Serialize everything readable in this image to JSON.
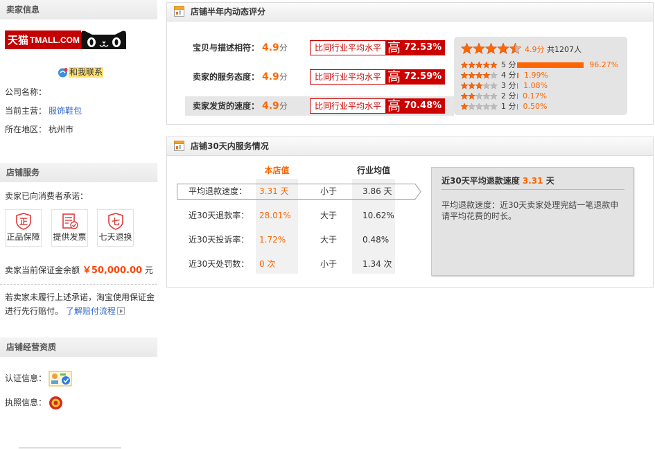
{
  "colors": {
    "accent": "#ff6600",
    "badge_red": "#cc0000",
    "link": "#3366cc"
  },
  "sidebar": {
    "seller_section": {
      "title": "卖家信息",
      "logo": {
        "cn": "天猫",
        "en": "TMALL.COM"
      },
      "contact_icon": "wangwang-chat-icon",
      "contact_label": "和我联系",
      "fields": [
        {
          "label": "公司名称：",
          "value": ""
        },
        {
          "label": "当前主营：",
          "value": "服饰鞋包"
        },
        {
          "label": "所在地区：",
          "value": "杭州市"
        }
      ]
    },
    "service_section": {
      "title": "店铺服务",
      "promise_label": "卖家已向消费者承诺：",
      "promises": [
        {
          "icon": "genuine-guarantee-icon",
          "glyph": "正",
          "label": "正品保障"
        },
        {
          "icon": "invoice-icon",
          "label": "提供发票"
        },
        {
          "icon": "seven-day-return-icon",
          "glyph": "七",
          "label": "七天退换"
        }
      ],
      "deposit": {
        "label": "卖家当前保证金余额",
        "amount": "￥50,000.00",
        "unit": "元"
      },
      "compensation_note": "若卖家未履行上述承诺，淘宝使用保证金进行先行赔付。",
      "compensation_link": "了解赔付流程"
    },
    "qualification_section": {
      "title": "店铺经营资质",
      "certification_label": "认证信息：",
      "certification_icon": "certification-icon",
      "license_label": "执照信息：",
      "license_icon": "business-license-icon"
    }
  },
  "dsr_panel": {
    "title": "店铺半年内动态评分",
    "items": [
      {
        "label": "宝贝与描述相符：",
        "score": "4.9",
        "unit": "分",
        "compare_text": "比同行业平均水平",
        "level": "高",
        "diff": "72.53%",
        "selected": false
      },
      {
        "label": "卖家的服务态度：",
        "score": "4.9",
        "unit": "分",
        "compare_text": "比同行业平均水平",
        "level": "高",
        "diff": "72.59%",
        "selected": false
      },
      {
        "label": "卖家发货的速度：",
        "score": "4.9",
        "unit": "分",
        "compare_text": "比同行业平均水平",
        "level": "高",
        "diff": "70.48%",
        "selected": true
      }
    ],
    "summary": {
      "stars_filled": 4.5,
      "score": "4.9分",
      "count": "共1207人",
      "distribution": [
        {
          "stars": 5,
          "label": "5 分",
          "percent": "96.27%"
        },
        {
          "stars": 4,
          "label": "4 分",
          "percent": "1.99%"
        },
        {
          "stars": 3,
          "label": "3 分",
          "percent": "1.08%"
        },
        {
          "stars": 2,
          "label": "2 分",
          "percent": "0.17%"
        },
        {
          "stars": 1,
          "label": "1 分",
          "percent": "0.50%"
        }
      ]
    }
  },
  "service_panel": {
    "title": "店铺30天内服务情况",
    "columns": {
      "shop": "本店值",
      "industry": "行业均值"
    },
    "rows": [
      {
        "label": "平均退款速度：",
        "shop": "3.31 天",
        "compare": "小于",
        "industry": "3.86 天",
        "selected": true
      },
      {
        "label": "近30天退款率：",
        "shop": "28.01%",
        "compare": "大于",
        "industry": "10.62%",
        "selected": false
      },
      {
        "label": "近30天投诉率：",
        "shop": "1.72%",
        "compare": "大于",
        "industry": "0.48%",
        "selected": false
      },
      {
        "label": "近30天处罚数：",
        "shop": "0 次",
        "compare": "小于",
        "industry": "1.34 次",
        "selected": false
      }
    ],
    "detail": {
      "title": "近30天平均退款速度",
      "value": "3.31",
      "unit": "天",
      "description": "平均退款速度：近30天卖家处理完结一笔退款申请平均花费的时长。"
    }
  }
}
